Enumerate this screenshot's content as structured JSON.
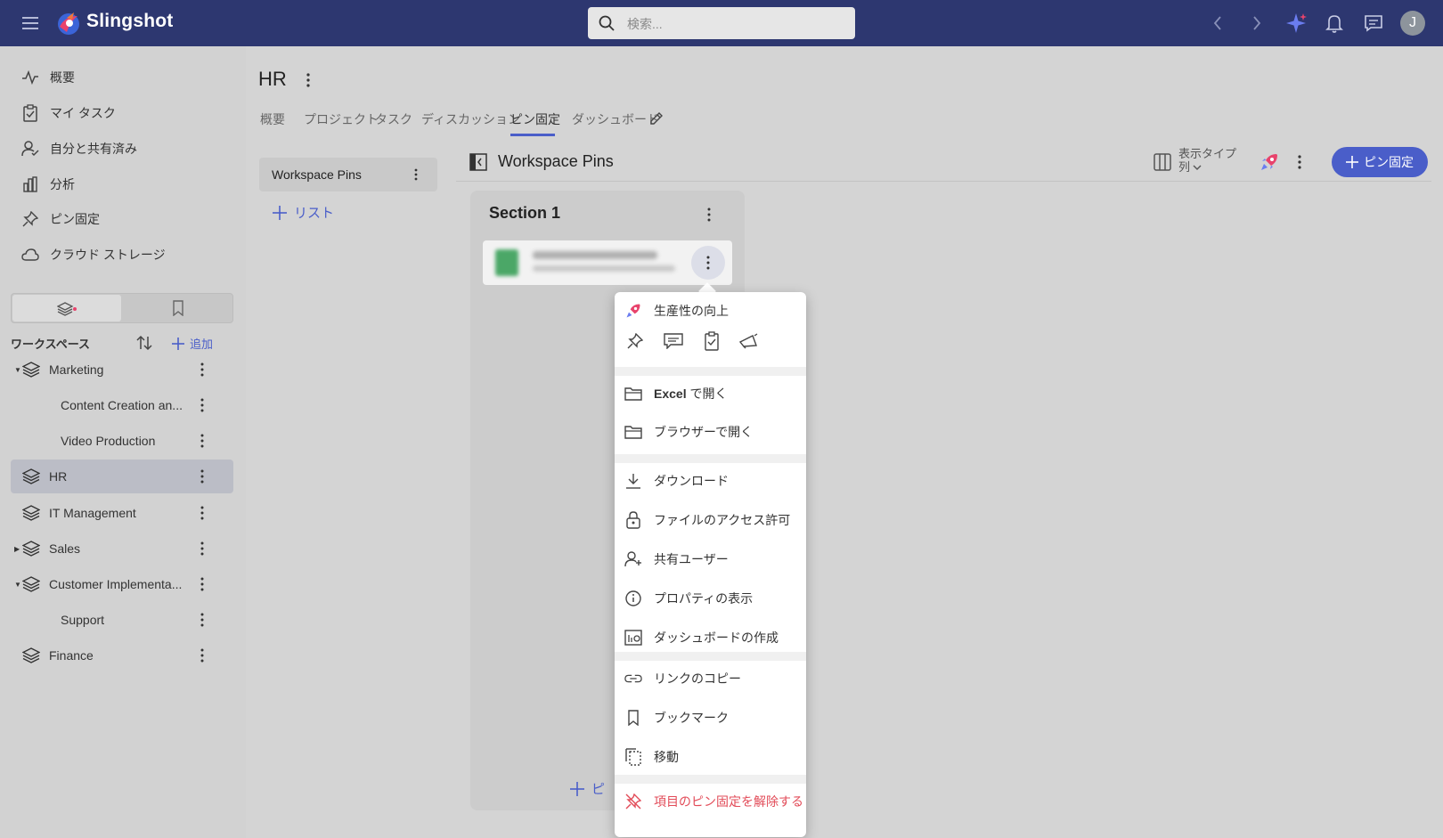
{
  "app": {
    "name": "Slingshot",
    "user_initial": "J",
    "accent": "#4a5ec9",
    "topbar_color": "#2d3770"
  },
  "search": {
    "placeholder": "検索..."
  },
  "topbar_icons": [
    "menu-icon",
    "back-arrow-icon",
    "forward-arrow-icon",
    "ai-sparkle-icon",
    "bell-icon",
    "chat-icon"
  ],
  "sidebar": {
    "nav": [
      {
        "label": "概要",
        "icon": "activity-icon"
      },
      {
        "label": "マイ タスク",
        "icon": "task-check-icon"
      },
      {
        "label": "自分と共有済み",
        "icon": "shared-user-icon"
      },
      {
        "label": "分析",
        "icon": "bar-chart-icon"
      },
      {
        "label": "ピン固定",
        "icon": "pin-icon"
      },
      {
        "label": "クラウド ストレージ",
        "icon": "cloud-icon"
      }
    ],
    "workspaces_label": "ワークスペース",
    "add_label": "追加",
    "workspaces": [
      {
        "label": "Marketing",
        "caret": "▼",
        "child": false,
        "selected": false
      },
      {
        "label": "Content Creation an...",
        "caret": "",
        "child": true,
        "selected": false
      },
      {
        "label": "Video Production",
        "caret": "",
        "child": true,
        "selected": false
      },
      {
        "label": "HR",
        "caret": "",
        "child": false,
        "selected": true
      },
      {
        "label": "IT Management",
        "caret": "",
        "child": false,
        "selected": false
      },
      {
        "label": "Sales",
        "caret": "▶",
        "child": false,
        "selected": false
      },
      {
        "label": "Customer Implementa...",
        "caret": "▼",
        "child": false,
        "selected": false
      },
      {
        "label": "Support",
        "caret": "",
        "child": true,
        "selected": false
      },
      {
        "label": "Finance",
        "caret": "",
        "child": false,
        "selected": false
      }
    ]
  },
  "workspace": {
    "title": "HR",
    "tabs": [
      "概要",
      "プロジェクト",
      "タスク",
      "ディスカッション",
      "ピン固定",
      "ダッシュボード"
    ],
    "active_tab": "ピン固定"
  },
  "pins": {
    "list_item": "Workspace Pins",
    "add_list": "リスト",
    "main_title": "Workspace Pins",
    "display_type_label": "表示タイプ",
    "display_type_value": "列",
    "pin_button": "ピン固定",
    "section_title": "Section 1",
    "section_footer": "ピ"
  },
  "context_menu": {
    "header": "生産性の向上",
    "quick_icons": [
      "pin-icon",
      "comment-icon",
      "task-check-icon",
      "announce-icon"
    ],
    "groups": [
      [
        {
          "label": "Excel で開く",
          "icon": "folder-icon",
          "bold_prefix": "Excel"
        },
        {
          "label": "ブラウザーで開く",
          "icon": "folder-icon"
        }
      ],
      [
        {
          "label": "ダウンロード",
          "icon": "download-icon"
        },
        {
          "label": "ファイルのアクセス許可",
          "icon": "lock-icon"
        },
        {
          "label": "共有ユーザー",
          "icon": "add-user-icon"
        },
        {
          "label": "プロパティの表示",
          "icon": "info-icon"
        },
        {
          "label": "ダッシュボードの作成",
          "icon": "dashboard-icon"
        }
      ],
      [
        {
          "label": "リンクのコピー",
          "icon": "link-icon"
        },
        {
          "label": "ブックマーク",
          "icon": "bookmark-icon"
        },
        {
          "label": "移動",
          "icon": "move-icon"
        }
      ],
      [
        {
          "label": "項目のピン固定を解除する",
          "icon": "unpin-icon",
          "danger": true
        }
      ]
    ]
  }
}
